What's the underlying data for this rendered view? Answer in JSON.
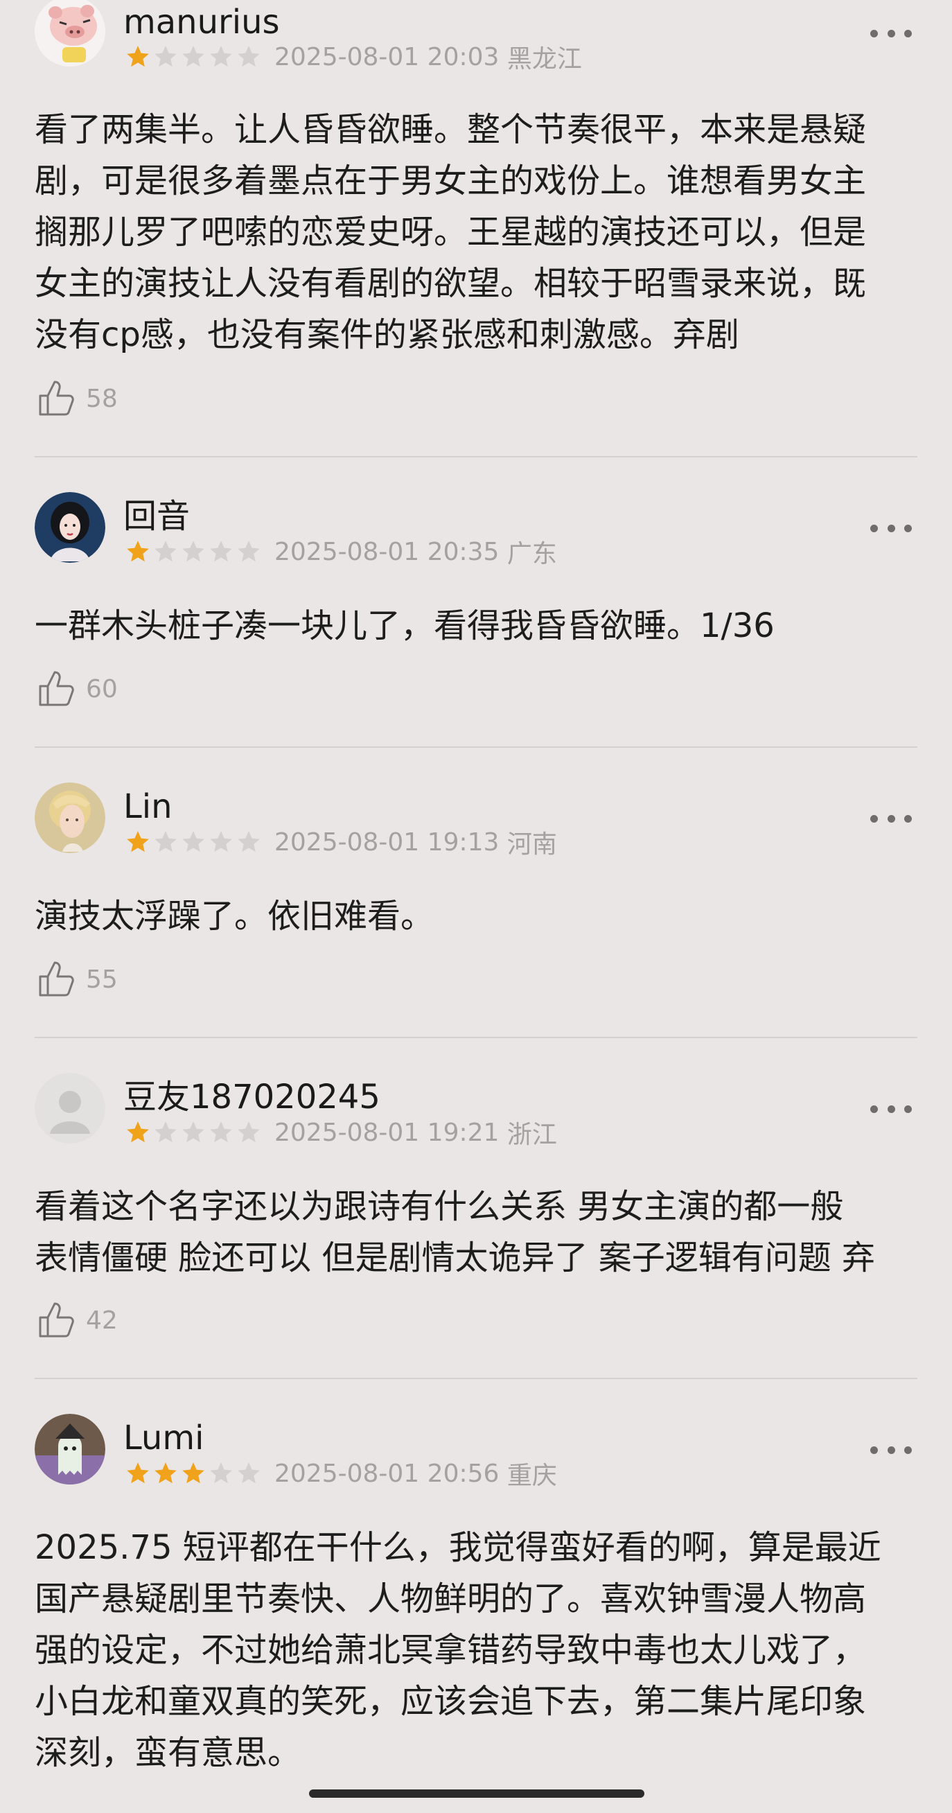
{
  "reviews": [
    {
      "username": "manurius",
      "rating": 1,
      "max_rating": 5,
      "datetime": "2025-08-01 20:03",
      "location": "黑龙江",
      "lines": [
        "看了两集半。让人昏昏欲睡。整个节奏很平，本来是悬疑",
        "剧，可是很多着墨点在于男女主的戏份上。谁想看男女主",
        "搁那儿罗了吧嗦的恋爱史呀。王星越的演技还可以，但是",
        "女主的演技让人没有看剧的欲望。相较于昭雪录来说，既",
        "没有cp感，也没有案件的紧张感和刺激感。弃剧"
      ],
      "likes": "58",
      "avatar_icon": "cartoon-pig-avatar"
    },
    {
      "username": "回音",
      "rating": 1,
      "max_rating": 5,
      "datetime": "2025-08-01 20:35",
      "location": "广东",
      "lines": [
        "一群木头桩子凑一块儿了，看得我昏昏欲睡。1/36"
      ],
      "likes": "60",
      "avatar_icon": "illustrated-woman-avatar"
    },
    {
      "username": "Lin",
      "rating": 1,
      "max_rating": 5,
      "datetime": "2025-08-01 19:13",
      "location": "河南",
      "lines": [
        "演技太浮躁了。依旧难看。"
      ],
      "likes": "55",
      "avatar_icon": "blond-person-avatar"
    },
    {
      "username": "豆友187020245",
      "rating": 1,
      "max_rating": 5,
      "datetime": "2025-08-01 19:21",
      "location": "浙江",
      "lines": [
        "看着这个名字还以为跟诗有什么关系 男女主演的都一般",
        "表情僵硬 脸还可以 但是剧情太诡异了 案子逻辑有问题 弃"
      ],
      "likes": "42",
      "avatar_icon": "default-person-avatar"
    },
    {
      "username": "Lumi",
      "rating": 3,
      "max_rating": 5,
      "datetime": "2025-08-01 20:56",
      "location": "重庆",
      "lines": [
        "2025.75 短评都在干什么，我觉得蛮好看的啊，算是最近",
        "国产悬疑剧里节奏快、人物鲜明的了。喜欢钟雪漫人物高",
        "强的设定，不过她给萧北冥拿错药导致中毒也太儿戏了，",
        "小白龙和童双真的笑死，应该会追下去，第二集片尾印象",
        "深刻，蛮有意思。"
      ],
      "likes": null,
      "avatar_icon": "ghost-character-avatar"
    }
  ],
  "colors": {
    "background": "#e9e6e5",
    "star_filled": "#f0a21a",
    "star_empty": "#d3d0cf",
    "meta_text": "#a4a2a1"
  }
}
